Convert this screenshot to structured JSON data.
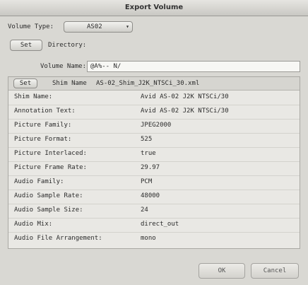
{
  "window": {
    "title": "Export Volume"
  },
  "volume_type": {
    "label": "Volume Type:",
    "selected": "AS02"
  },
  "set_directory": {
    "button": "Set",
    "label": "Directory:"
  },
  "volume_name": {
    "label": "Volume Name:",
    "value": "@A%-- N/"
  },
  "shim": {
    "button": "Set",
    "label": "Shim Name",
    "value": "AS-02_Shim_J2K_NTSCi_30.xml"
  },
  "properties": [
    {
      "key": "Shim Name:",
      "value": "Avid AS-02 J2K NTSCi/30"
    },
    {
      "key": "Annotation Text:",
      "value": "Avid AS-02 J2K NTSCi/30"
    },
    {
      "key": "Picture Family:",
      "value": "JPEG2000"
    },
    {
      "key": "Picture Format:",
      "value": "525"
    },
    {
      "key": "Picture Interlaced:",
      "value": "true"
    },
    {
      "key": "Picture Frame Rate:",
      "value": "29.97"
    },
    {
      "key": "Audio Family:",
      "value": "PCM"
    },
    {
      "key": "Audio Sample Rate:",
      "value": "48000"
    },
    {
      "key": "Audio Sample Size:",
      "value": "24"
    },
    {
      "key": "Audio Mix:",
      "value": "direct_out"
    },
    {
      "key": "Audio File Arrangement:",
      "value": "mono"
    }
  ],
  "footer": {
    "ok": "OK",
    "cancel": "Cancel"
  }
}
